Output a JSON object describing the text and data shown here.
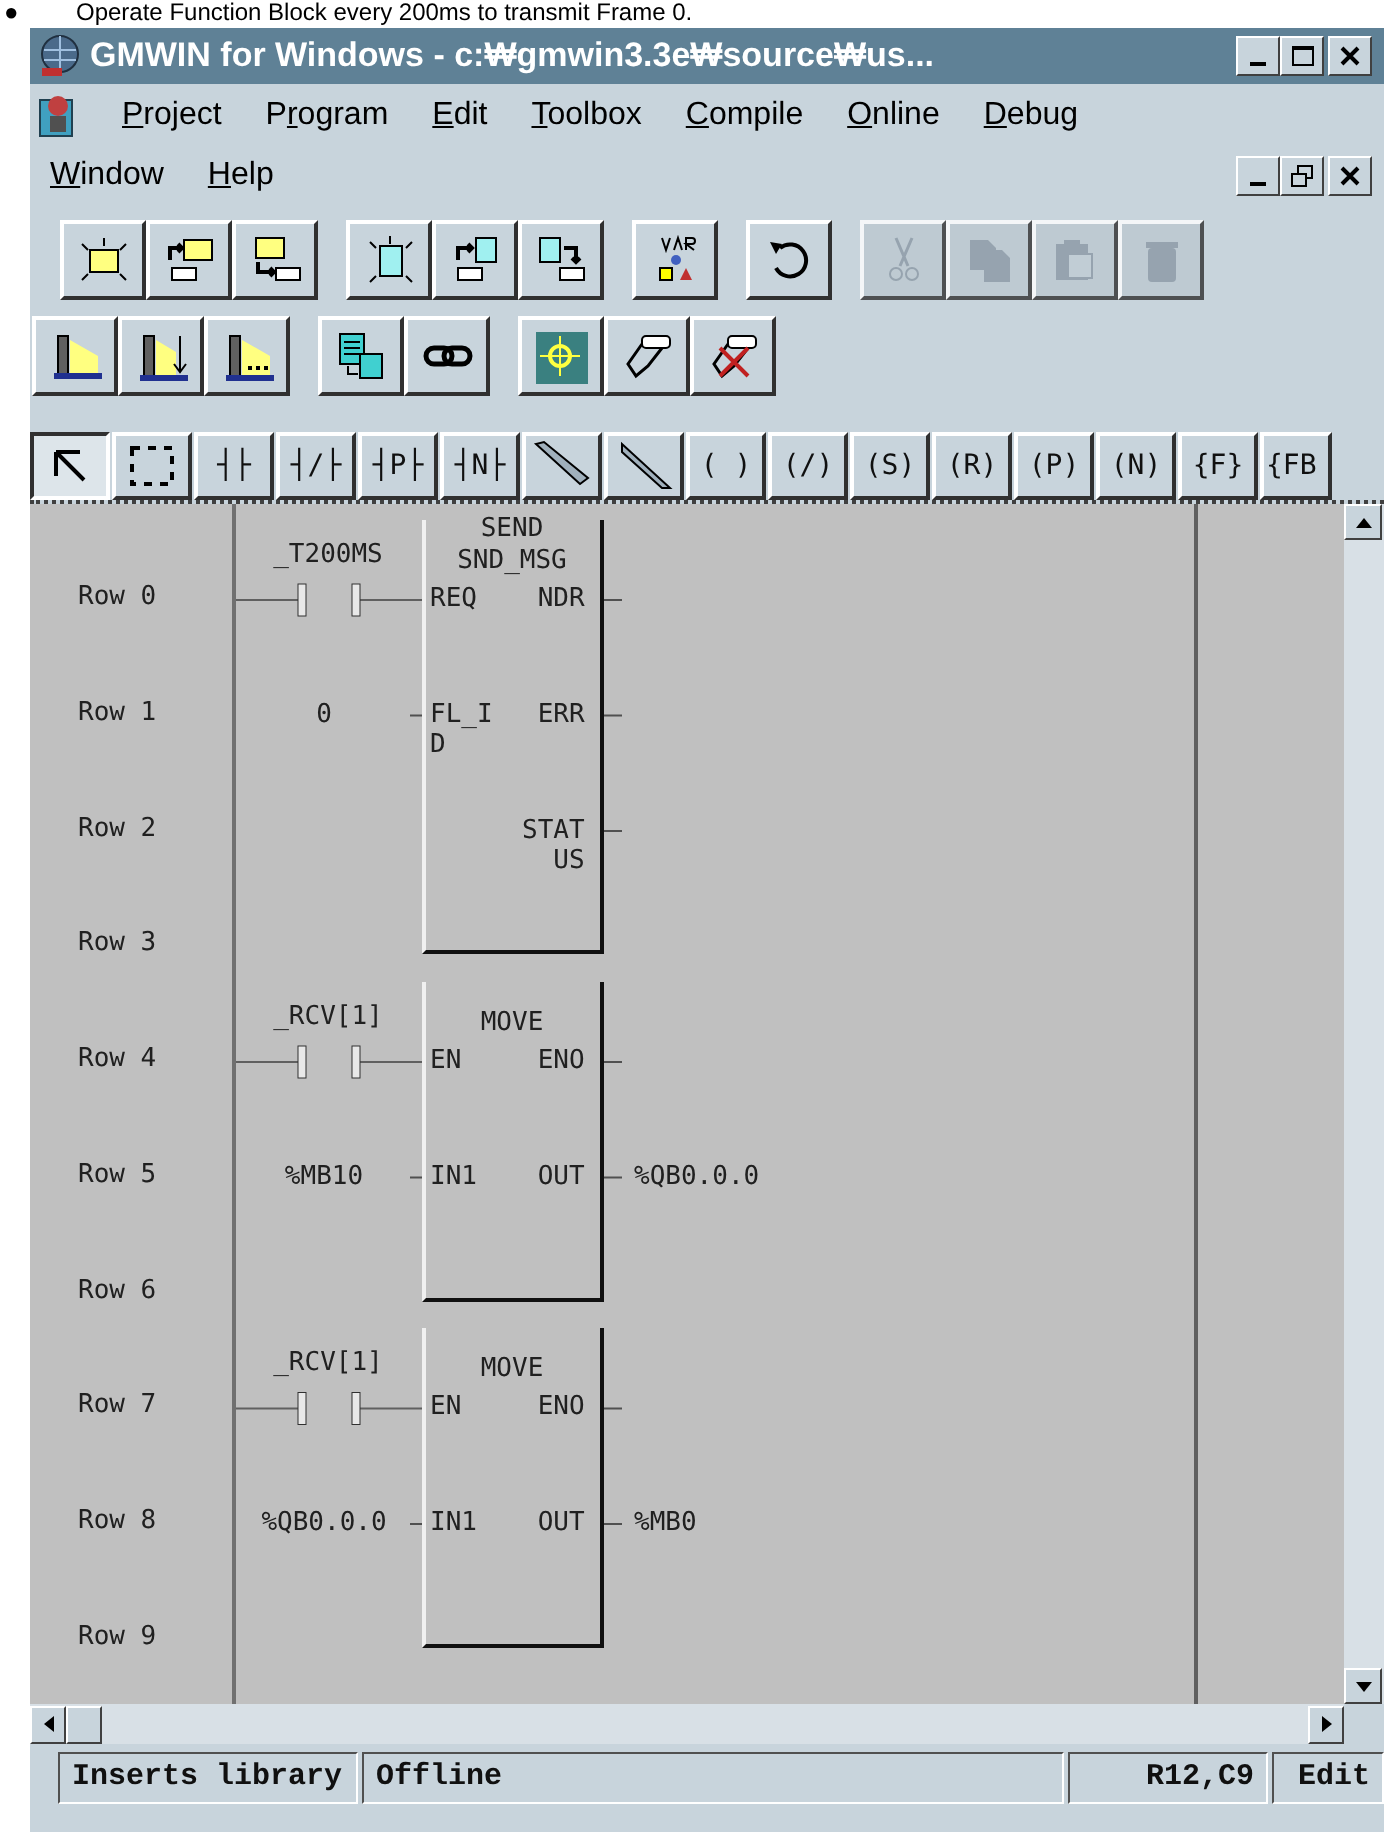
{
  "caption": {
    "bullet": "●",
    "text": "Operate Function Block every 200ms to transmit Frame 0."
  },
  "window": {
    "title": "GMWIN for Windows - c:₩gmwin3.3e₩source₩us..."
  },
  "menu": [
    {
      "key": "P",
      "post": "roject"
    },
    {
      "pre": "P",
      "key": "r",
      "post": "ogram"
    },
    {
      "key": "E",
      "post": "dit"
    },
    {
      "key": "T",
      "post": "oolbox"
    },
    {
      "key": "C",
      "post": "ompile"
    },
    {
      "key": "O",
      "post": "nline"
    },
    {
      "key": "D",
      "post": "ebug"
    },
    {
      "key": "W",
      "post": "indow"
    },
    {
      "key": "H",
      "post": "elp"
    }
  ],
  "toolbar_rows": [
    [
      [
        {
          "kind": "new-project",
          "disabled": false
        },
        {
          "kind": "open-project",
          "disabled": false
        },
        {
          "kind": "save-project",
          "disabled": false
        }
      ],
      [
        {
          "kind": "new-file",
          "disabled": false
        },
        {
          "kind": "open-file",
          "disabled": false
        },
        {
          "kind": "save-file",
          "disabled": false
        }
      ],
      [
        {
          "kind": "variables",
          "disabled": false
        }
      ],
      [
        {
          "kind": "undo",
          "disabled": false
        }
      ],
      [
        {
          "kind": "cut",
          "disabled": true
        },
        {
          "kind": "copy",
          "disabled": true
        },
        {
          "kind": "paste",
          "disabled": true
        },
        {
          "kind": "delete",
          "disabled": true
        }
      ]
    ],
    [
      [
        {
          "kind": "plc-read",
          "disabled": false
        },
        {
          "kind": "plc-compare",
          "disabled": false
        },
        {
          "kind": "plc-write",
          "disabled": false
        }
      ],
      [
        {
          "kind": "convert",
          "disabled": false
        },
        {
          "kind": "link",
          "disabled": false
        }
      ],
      [
        {
          "kind": "monitor",
          "disabled": false
        },
        {
          "kind": "connect",
          "disabled": false
        },
        {
          "kind": "disconnect",
          "disabled": false
        }
      ]
    ]
  ],
  "ladder_tools": [
    {
      "kind": "pointer",
      "selected": true
    },
    {
      "kind": "select",
      "selected": false
    },
    {
      "kind": "text",
      "label": "┤├",
      "selected": false
    },
    {
      "kind": "text",
      "label": "┤/├",
      "selected": false
    },
    {
      "kind": "text",
      "label": "┤P├",
      "selected": false
    },
    {
      "kind": "text",
      "label": "┤N├",
      "selected": false
    },
    {
      "kind": "line-down",
      "selected": false
    },
    {
      "kind": "line-up",
      "selected": false
    },
    {
      "kind": "text",
      "label": "( )",
      "selected": false
    },
    {
      "kind": "text",
      "label": "(/)",
      "selected": false
    },
    {
      "kind": "text",
      "label": "(S)",
      "selected": false
    },
    {
      "kind": "text",
      "label": "(R)",
      "selected": false
    },
    {
      "kind": "text",
      "label": "(P)",
      "selected": false
    },
    {
      "kind": "text",
      "label": "(N)",
      "selected": false
    },
    {
      "kind": "text",
      "label": "{F}",
      "selected": false
    },
    {
      "kind": "text",
      "label": "{FB",
      "selected": false
    }
  ],
  "ladder": {
    "row_labels": [
      "Row 0",
      "Row 1",
      "Row 2",
      "Row 3",
      "Row 4",
      "Row 5",
      "Row 6",
      "Row 7",
      "Row 8",
      "Row 9"
    ],
    "rungs": [
      {
        "contact": "_T200MS",
        "block_type": "SEND",
        "block_name": "SND_MSG",
        "pins": [
          {
            "in": "REQ",
            "out": "NDR"
          },
          {
            "in": "FL_ID",
            "in_value": "0",
            "out": "ERR"
          },
          {
            "out": "STATUS"
          }
        ]
      },
      {
        "contact": "_RCV[1]",
        "block_name": "MOVE",
        "pins": [
          {
            "in": "EN",
            "out": "ENO"
          },
          {
            "in": "IN1",
            "in_value": "%MB10",
            "out": "OUT",
            "out_value": "%QB0.0.0"
          }
        ]
      },
      {
        "contact": "_RCV[1]",
        "block_name": "MOVE",
        "pins": [
          {
            "in": "EN",
            "out": "ENO"
          },
          {
            "in": "IN1",
            "in_value": "%QB0.0.0",
            "out": "OUT",
            "out_value": "%MB0"
          }
        ]
      }
    ]
  },
  "status_bar": [
    "Inserts library",
    "Offline",
    "R12,C9",
    "Edit"
  ]
}
